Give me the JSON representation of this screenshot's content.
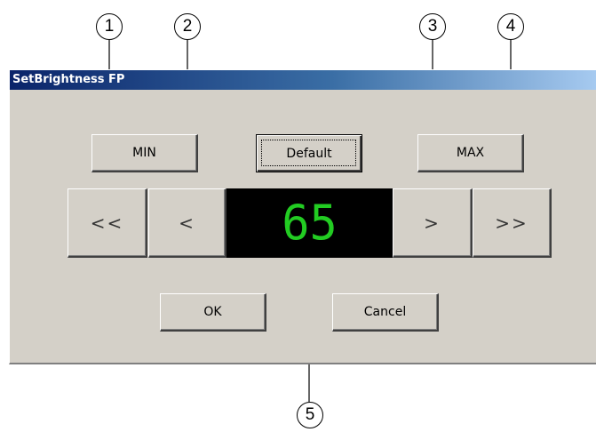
{
  "window": {
    "title": "SetBrightness FP"
  },
  "buttons": {
    "min": "MIN",
    "default": "Default",
    "max": "MAX",
    "decrease_large": "<<",
    "decrease": "<",
    "increase": ">",
    "increase_large": ">>",
    "ok": "OK",
    "cancel": "Cancel"
  },
  "display": {
    "value": "65",
    "color": "#22cc22"
  },
  "callouts": [
    "1",
    "2",
    "3",
    "4",
    "5"
  ]
}
